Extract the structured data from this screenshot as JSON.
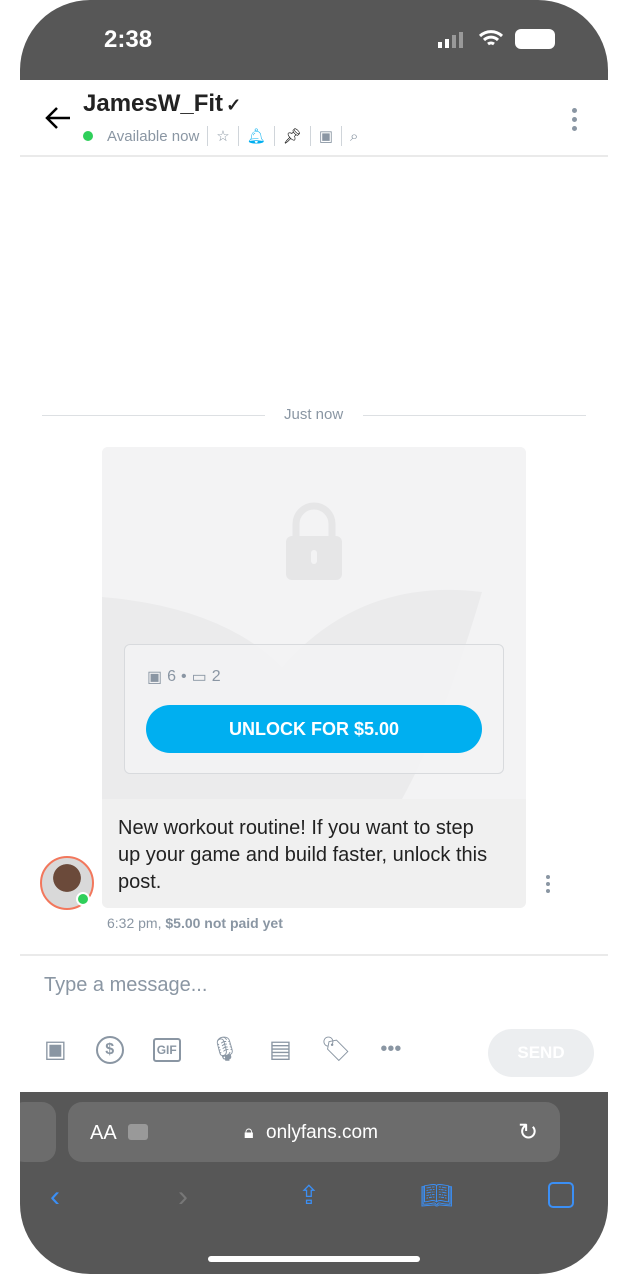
{
  "status_bar": {
    "time": "2:38"
  },
  "header": {
    "title": "JamesW_Fit",
    "status": "Available now"
  },
  "chat": {
    "timestamp_divider": "Just now",
    "message": {
      "photo_count": "6",
      "video_count": "2",
      "separator": "•",
      "unlock_label": "UNLOCK FOR $5.00",
      "text": "New workout routine!  If you want to step up your game and build faster, unlock this post.",
      "time": "6:32 pm,",
      "price_status": "$5.00 not paid yet"
    }
  },
  "composer": {
    "placeholder": "Type a message...",
    "send_label": "SEND"
  },
  "browser": {
    "text_size": "AA",
    "url": "onlyfans.com"
  },
  "colors": {
    "accent": "#00aff0",
    "online": "#2fcf5a"
  }
}
